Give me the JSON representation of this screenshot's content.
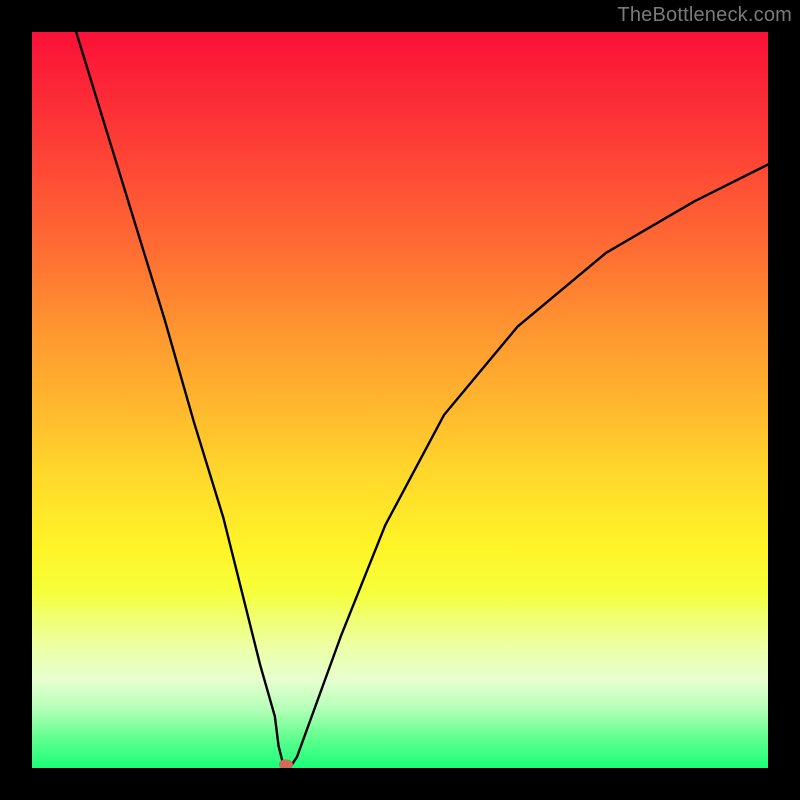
{
  "watermark": "TheBottleneck.com",
  "chart_data": {
    "type": "line",
    "title": "",
    "xlabel": "",
    "ylabel": "",
    "xlim": [
      0,
      100
    ],
    "ylim": [
      0,
      100
    ],
    "series": [
      {
        "name": "bottleneck-curve",
        "x": [
          6,
          10,
          14,
          18,
          22,
          26,
          29,
          31,
          33,
          33.5,
          34,
          34.5,
          35,
          36,
          38,
          42,
          48,
          56,
          66,
          78,
          90,
          100
        ],
        "y": [
          100,
          87,
          74,
          61,
          47,
          34,
          22,
          14,
          7,
          3,
          1,
          0,
          0,
          1.5,
          7,
          18,
          33,
          48,
          60,
          70,
          77,
          82
        ]
      }
    ],
    "marker": {
      "x": 34.5,
      "y": 0.5,
      "color": "#d46a5a",
      "label": "optimal-point"
    },
    "gradient_stops": [
      {
        "pos": 0,
        "color": "#fb1038"
      },
      {
        "pos": 14,
        "color": "#fd3a36"
      },
      {
        "pos": 30,
        "color": "#ff6e33"
      },
      {
        "pos": 40,
        "color": "#ff9430"
      },
      {
        "pos": 52,
        "color": "#ffbb2e"
      },
      {
        "pos": 60,
        "color": "#ffd82b"
      },
      {
        "pos": 70,
        "color": "#fff428"
      },
      {
        "pos": 76,
        "color": "#f6ff3a"
      },
      {
        "pos": 83,
        "color": "#edffa0"
      },
      {
        "pos": 88,
        "color": "#e7ffd0"
      },
      {
        "pos": 92,
        "color": "#b4ffb8"
      },
      {
        "pos": 96,
        "color": "#5eff8e"
      },
      {
        "pos": 100,
        "color": "#1aff78"
      }
    ]
  }
}
